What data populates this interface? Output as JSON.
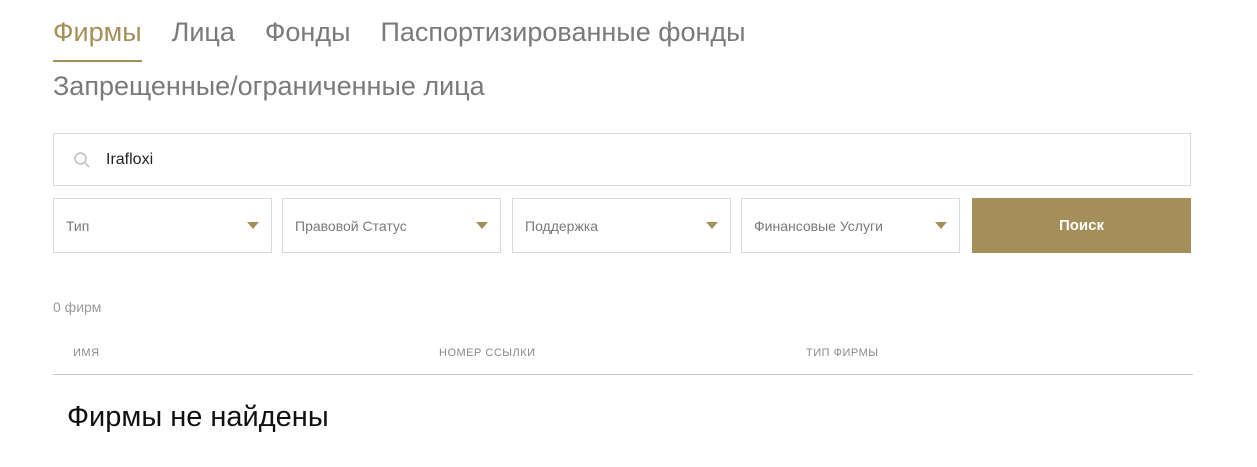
{
  "tabs": [
    {
      "label": "Фирмы",
      "active": true
    },
    {
      "label": "Лица",
      "active": false
    },
    {
      "label": "Фонды",
      "active": false
    },
    {
      "label": "Паспортизированные фонды",
      "active": false
    },
    {
      "label": "Запрещенные/ограниченные лица",
      "active": false
    }
  ],
  "search": {
    "value": "Irafloxi",
    "icon": "search-icon"
  },
  "filters": [
    {
      "label": "Тип"
    },
    {
      "label": "Правовой Статус"
    },
    {
      "label": "Поддержка"
    },
    {
      "label": "Финансовые Услуги"
    }
  ],
  "search_button": {
    "label": "Поиск"
  },
  "results": {
    "count_text": "0 фирм",
    "columns": [
      "ИМЯ",
      "НОМЕР ССЫЛКИ",
      "ТИП ФИРМЫ"
    ],
    "empty_message": "Фирмы не найдены"
  },
  "colors": {
    "accent": "#a48f5a",
    "muted_text": "#7a7a7a",
    "border": "#d9d9d9"
  }
}
